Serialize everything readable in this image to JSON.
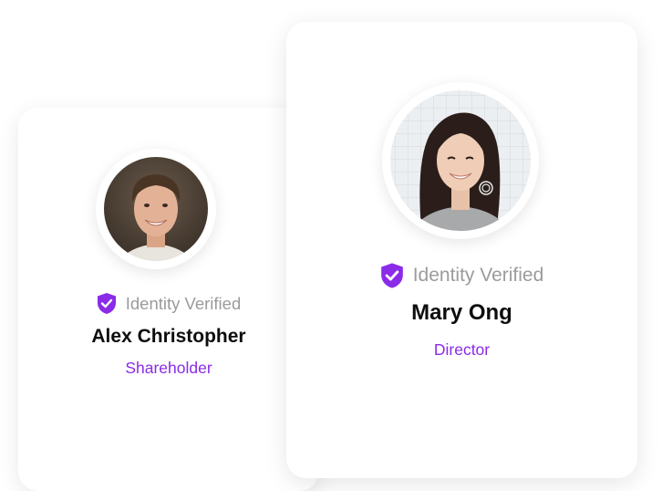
{
  "colors": {
    "accent": "#8b2be8",
    "verified_text": "#9b9b9b",
    "name_text": "#0d0d0d",
    "card_background": "#ffffff"
  },
  "cards": [
    {
      "avatar": "male-portrait-photo",
      "verified_icon": "shield-check-icon",
      "verified_label": "Identity Verified",
      "name": "Alex Christopher",
      "role": "Shareholder"
    },
    {
      "avatar": "female-portrait-photo",
      "verified_icon": "shield-check-icon",
      "verified_label": "Identity Verified",
      "name": "Mary Ong",
      "role": "Director"
    }
  ]
}
